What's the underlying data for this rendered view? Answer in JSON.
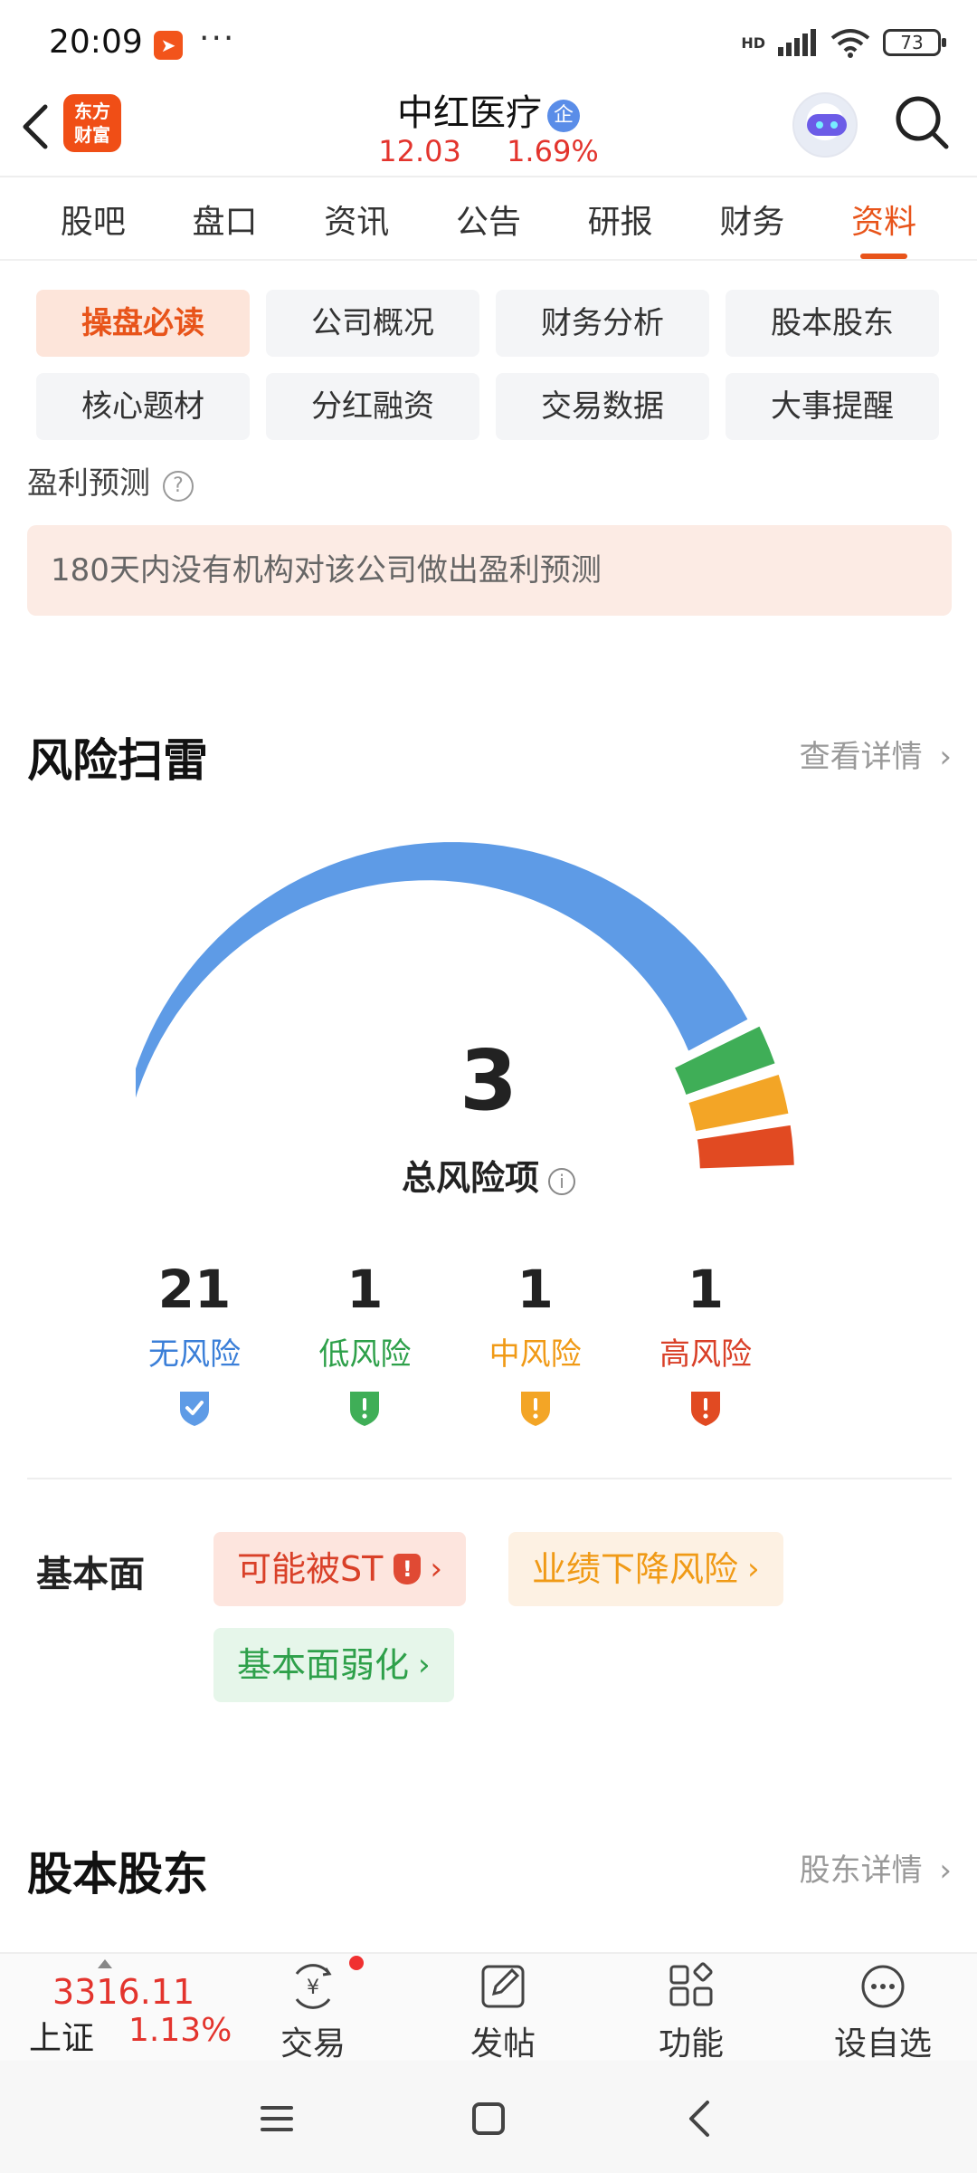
{
  "status_bar": {
    "time": "20:09",
    "dots": "···",
    "network": "HD",
    "battery": "73"
  },
  "header": {
    "brand_logo": "东方\n财富",
    "stock_name": "中红医疗",
    "verified_badge": "企",
    "price": "12.03",
    "change_pct": "1.69%"
  },
  "tabs": [
    "股吧",
    "盘口",
    "资讯",
    "公告",
    "研报",
    "财务",
    "资料"
  ],
  "active_tab": "资料",
  "chips": [
    "操盘必读",
    "公司概况",
    "财务分析",
    "股本股东",
    "核心题材",
    "分红融资",
    "交易数据",
    "大事提醒"
  ],
  "profit_forecast": {
    "label": "盈利预测",
    "help": "?",
    "notice": "180天内没有机构对该公司做出盈利预测"
  },
  "risk_scan": {
    "title": "风险扫雷",
    "more": "查看详情",
    "total": "3",
    "total_caption": "总风险项",
    "info": "i",
    "gauge_segments": [
      {
        "name": "无风险",
        "count": 21,
        "color": "#5e9be6"
      },
      {
        "name": "低风险",
        "count": 1,
        "color": "#3fae57"
      },
      {
        "name": "中风险",
        "count": 1,
        "color": "#f3a526"
      },
      {
        "name": "高风险",
        "count": 1,
        "color": "#e14a22"
      }
    ],
    "levels": [
      {
        "count": "21",
        "label": "无风险",
        "color": "#3b7fd8",
        "icon": "check-shield-icon"
      },
      {
        "count": "1",
        "label": "低风险",
        "color": "#2ea04a",
        "icon": "exclamation-shield-icon"
      },
      {
        "count": "1",
        "label": "中风险",
        "color": "#f09a16",
        "icon": "exclamation-shield-icon"
      },
      {
        "count": "1",
        "label": "高风险",
        "color": "#d94028",
        "icon": "exclamation-shield-icon"
      }
    ],
    "fundamentals": {
      "label": "基本面",
      "tag_st": "可能被ST",
      "tag_perf": "业绩下降风险",
      "tag_weak": "基本面弱化"
    }
  },
  "equity": {
    "title": "股本股东",
    "more": "股东详情"
  },
  "bottom_bar": {
    "index_value": "3316.11",
    "index_name": "上证",
    "index_change": "1.13%",
    "trade": "交易",
    "post": "发帖",
    "functions": "功能",
    "watchlist": "设自选"
  }
}
